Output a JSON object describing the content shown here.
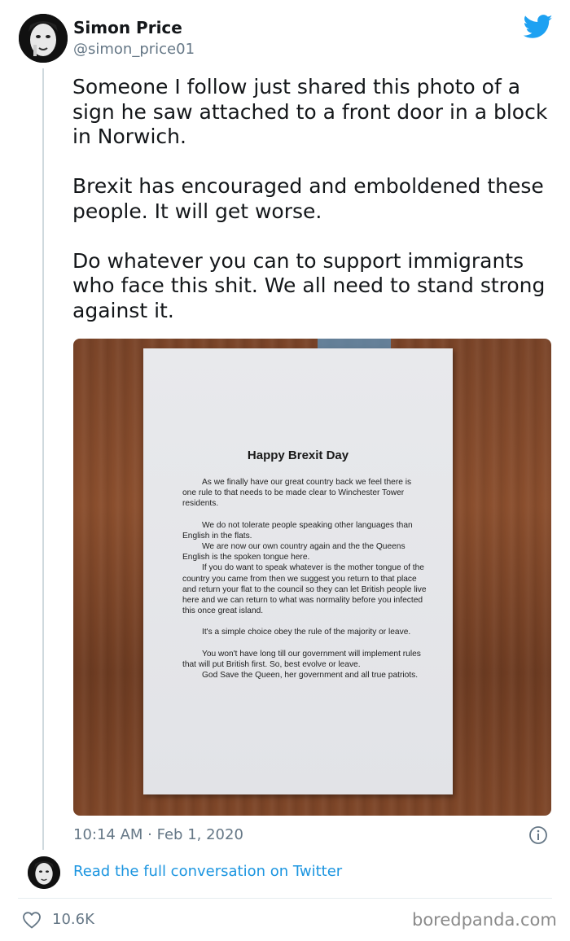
{
  "tweet": {
    "author_name": "Simon Price",
    "author_badge": "",
    "author_handle": "@simon_price01",
    "text": "Someone I follow just shared this photo of a sign he saw attached to a front door in a block in Norwich.\n\nBrexit has encouraged and emboldened these people. It will get worse.\n\nDo whatever you can to support immigrants who face this shit. We all need to stand strong against it.",
    "timestamp": "10:14 AM · Feb 1, 2020",
    "read_more": "Read the full conversation on Twitter",
    "likes": "10.6K"
  },
  "photo": {
    "sign_title": "Happy Brexit Day",
    "sign_paragraphs": [
      "As we finally have our great country back we feel there is one rule to that needs to be made clear to Winchester Tower residents.",
      "",
      "We do not tolerate people speaking other languages than English in the flats.",
      "We are now our own country again and the the Queens English is the spoken tongue here.",
      "If you do want to speak whatever is the mother tongue of the country you came from then we suggest you return to that place and return your flat to the council so they can let British people live here and we can return to what was normality before you infected this once great island.",
      "",
      "It's a simple choice obey the rule of the majority or leave.",
      "",
      "You won't have long till our government will implement rules that will put British first. So, best evolve or leave.",
      "God Save the Queen, her government and all true patriots."
    ]
  },
  "watermark": "boredpanda.com",
  "icons": {
    "brand": "twitter-bird-icon",
    "info": "info-icon",
    "like": "heart-icon"
  },
  "colors": {
    "link": "#1b95e0",
    "muted": "#657786",
    "twitter_blue": "#1da1f2"
  }
}
